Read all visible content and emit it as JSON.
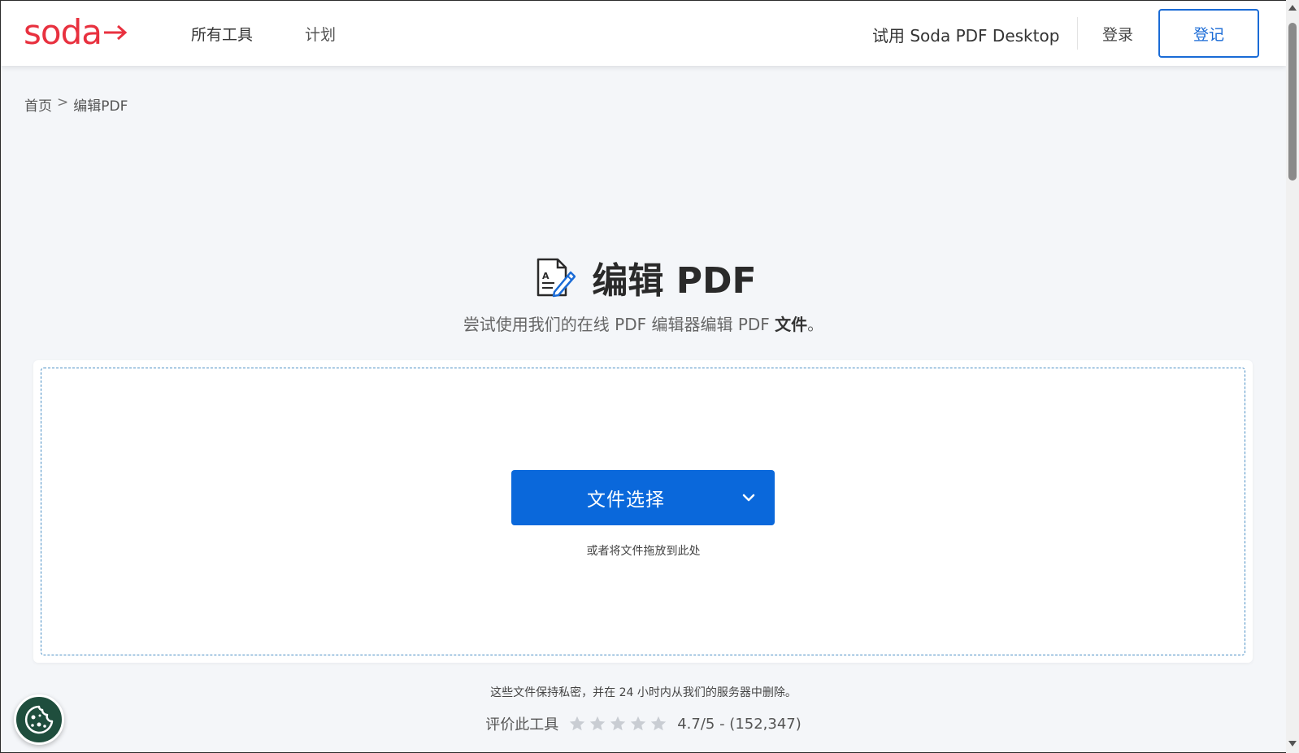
{
  "header": {
    "logo_text": "soda",
    "nav": [
      {
        "label": "所有工具"
      },
      {
        "label": "计划"
      }
    ],
    "try_desktop": "试用 Soda PDF Desktop",
    "login": "登录",
    "register": "登记"
  },
  "breadcrumb": {
    "home": "首页",
    "separator": ">",
    "current": "编辑PDF"
  },
  "main": {
    "title": "编辑 PDF",
    "subtitle_prefix": "尝试使用我们的在线 PDF 编辑器编辑 PDF ",
    "subtitle_bold": "文件",
    "subtitle_suffix": "。",
    "choose_button": "文件选择",
    "drop_hint": "或者将文件拖放到此处",
    "privacy": "这些文件保持私密，并在 24 小时内从我们的服务器中删除。",
    "rating_label": "评价此工具",
    "rating_stars": 5,
    "rating_value": "4.7/5 - (152,347)"
  },
  "icons": {
    "logo_arrow": "arrow-right-icon",
    "title_icon": "document-edit-icon",
    "chevron": "chevron-down-icon",
    "cookie": "cookie-icon",
    "star": "star-icon"
  },
  "colors": {
    "brand_red": "#e8313f",
    "primary_blue": "#0a68db",
    "cookie_green": "#1f4e3d"
  }
}
